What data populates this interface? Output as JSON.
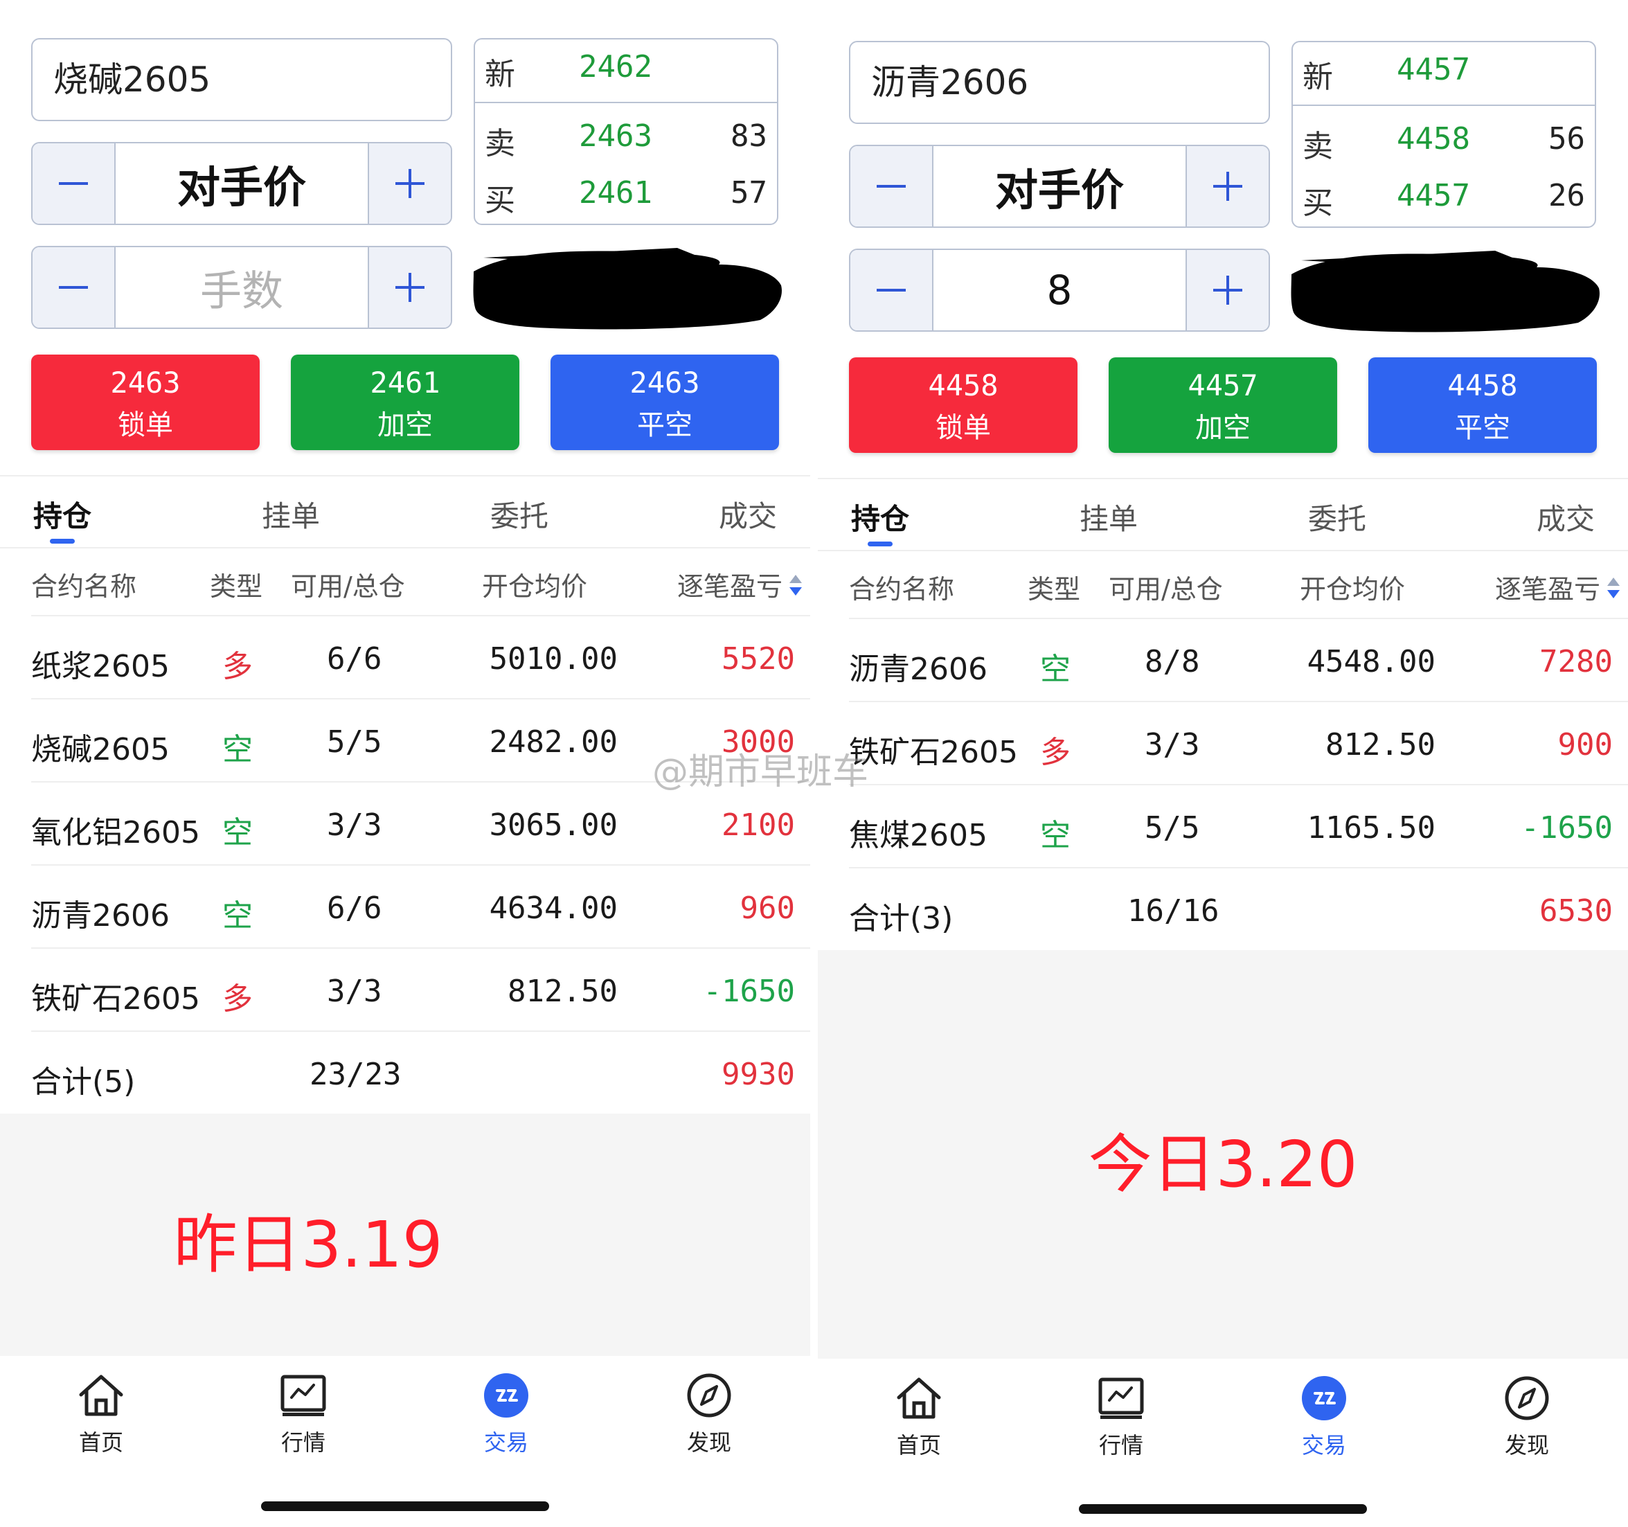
{
  "left": {
    "contract": "烧碱2605",
    "price_mode": "对手价",
    "qty_placeholder": "手数",
    "qty_value": "",
    "quote": {
      "new_label": "新",
      "new_price": "2462",
      "sell_label": "卖",
      "sell_price": "2463",
      "sell_vol": "83",
      "buy_label": "买",
      "buy_price": "2461",
      "buy_vol": "57"
    },
    "actions": [
      {
        "price": "2463",
        "label": "锁单"
      },
      {
        "price": "2461",
        "label": "加空"
      },
      {
        "price": "2463",
        "label": "平空"
      }
    ],
    "tabs": [
      "持仓",
      "挂单",
      "委托",
      "成交"
    ],
    "columns": [
      "合约名称",
      "类型",
      "可用/总仓",
      "开仓均价",
      "逐笔盈亏"
    ],
    "rows": [
      {
        "name": "纸浆2605",
        "type": "多",
        "qty": "6/6",
        "avg": "5010.00",
        "pnl": "5520"
      },
      {
        "name": "烧碱2605",
        "type": "空",
        "qty": "5/5",
        "avg": "2482.00",
        "pnl": "3000"
      },
      {
        "name": "氧化铝2605",
        "type": "空",
        "qty": "3/3",
        "avg": "3065.00",
        "pnl": "2100"
      },
      {
        "name": "沥青2606",
        "type": "空",
        "qty": "6/6",
        "avg": "4634.00",
        "pnl": "960"
      },
      {
        "name": "铁矿石2605",
        "type": "多",
        "qty": "3/3",
        "avg": "812.50",
        "pnl": "-1650"
      }
    ],
    "total": {
      "label": "合计(5)",
      "qty": "23/23",
      "pnl": "9930"
    },
    "annotation": "昨日3.19"
  },
  "right": {
    "contract": "沥青2606",
    "price_mode": "对手价",
    "qty_placeholder": "手数",
    "qty_value": "8",
    "quote": {
      "new_label": "新",
      "new_price": "4457",
      "sell_label": "卖",
      "sell_price": "4458",
      "sell_vol": "56",
      "buy_label": "买",
      "buy_price": "4457",
      "buy_vol": "26"
    },
    "actions": [
      {
        "price": "4458",
        "label": "锁单"
      },
      {
        "price": "4457",
        "label": "加空"
      },
      {
        "price": "4458",
        "label": "平空"
      }
    ],
    "tabs": [
      "持仓",
      "挂单",
      "委托",
      "成交"
    ],
    "columns": [
      "合约名称",
      "类型",
      "可用/总仓",
      "开仓均价",
      "逐笔盈亏"
    ],
    "rows": [
      {
        "name": "沥青2606",
        "type": "空",
        "qty": "8/8",
        "avg": "4548.00",
        "pnl": "7280"
      },
      {
        "name": "铁矿石2605",
        "type": "多",
        "qty": "3/3",
        "avg": "812.50",
        "pnl": "900"
      },
      {
        "name": "焦煤2605",
        "type": "空",
        "qty": "5/5",
        "avg": "1165.50",
        "pnl": "-1650"
      }
    ],
    "total": {
      "label": "合计(3)",
      "qty": "16/16",
      "pnl": "6530"
    },
    "annotation": "今日3.20"
  },
  "nav": [
    {
      "label": "首页",
      "icon": "home-icon"
    },
    {
      "label": "行情",
      "icon": "chart-icon"
    },
    {
      "label": "交易",
      "icon": "trade-icon"
    },
    {
      "label": "发现",
      "icon": "compass-icon"
    }
  ],
  "watermark": "@期市早班车",
  "colors": {
    "accent": "#2f64f0",
    "profit": "#e2323d",
    "loss": "#1ea34a",
    "btn_red": "#f62a3c",
    "btn_green": "#15a33e",
    "btn_blue": "#2f64f0",
    "annotation": "#ff1e2a"
  }
}
